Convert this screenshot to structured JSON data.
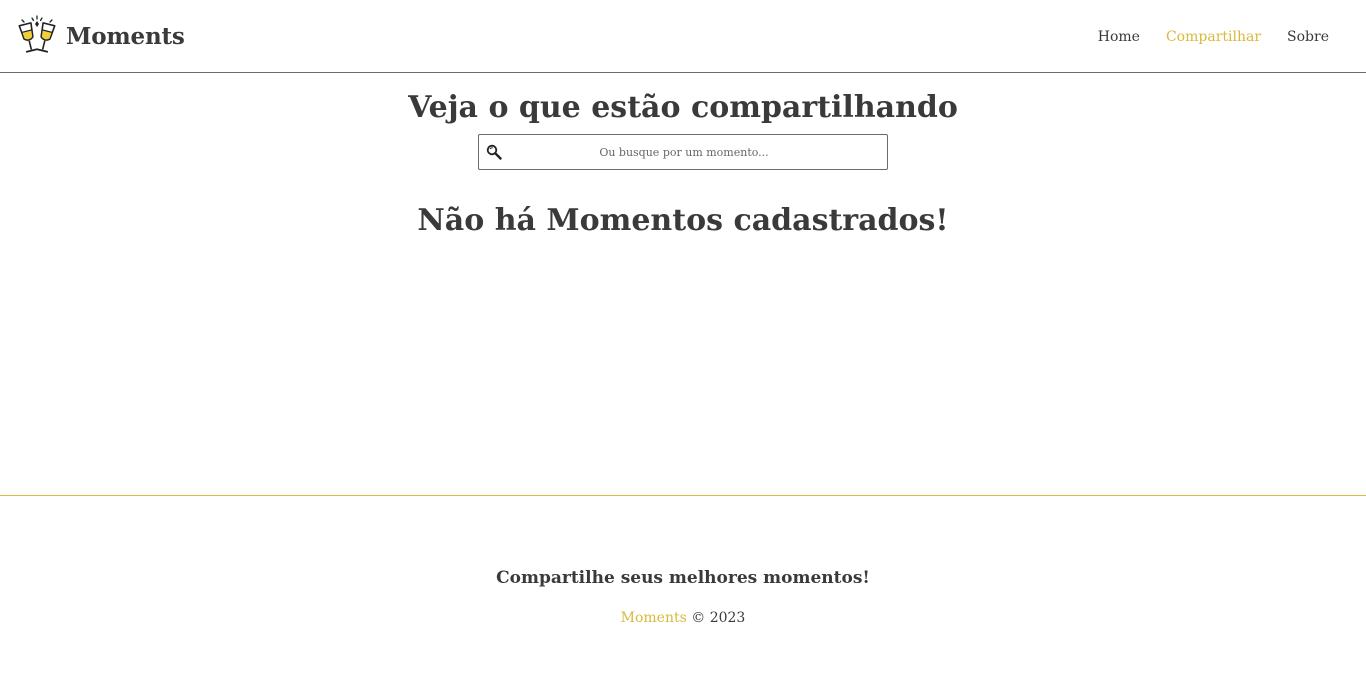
{
  "colors": {
    "accent": "#d8b93a",
    "text": "#3a3a3a",
    "header_border": "#6b6b6b",
    "footer_border": "#d8c04a"
  },
  "header": {
    "brand_icon": "champagne-toast-icon",
    "brand_name": "Moments",
    "nav": [
      {
        "label": "Home",
        "active": false
      },
      {
        "label": "Compartilhar",
        "active": true
      },
      {
        "label": "Sobre",
        "active": false
      }
    ]
  },
  "main": {
    "title": "Veja o que estão compartilhando",
    "search": {
      "icon": "search-icon",
      "placeholder": "Ou busque por um momento..."
    },
    "empty_message": "Não há Momentos cadastrados!"
  },
  "footer": {
    "tagline": "Compartilhe seus melhores momentos!",
    "brand": "Moments",
    "copyright": "© 2023"
  }
}
